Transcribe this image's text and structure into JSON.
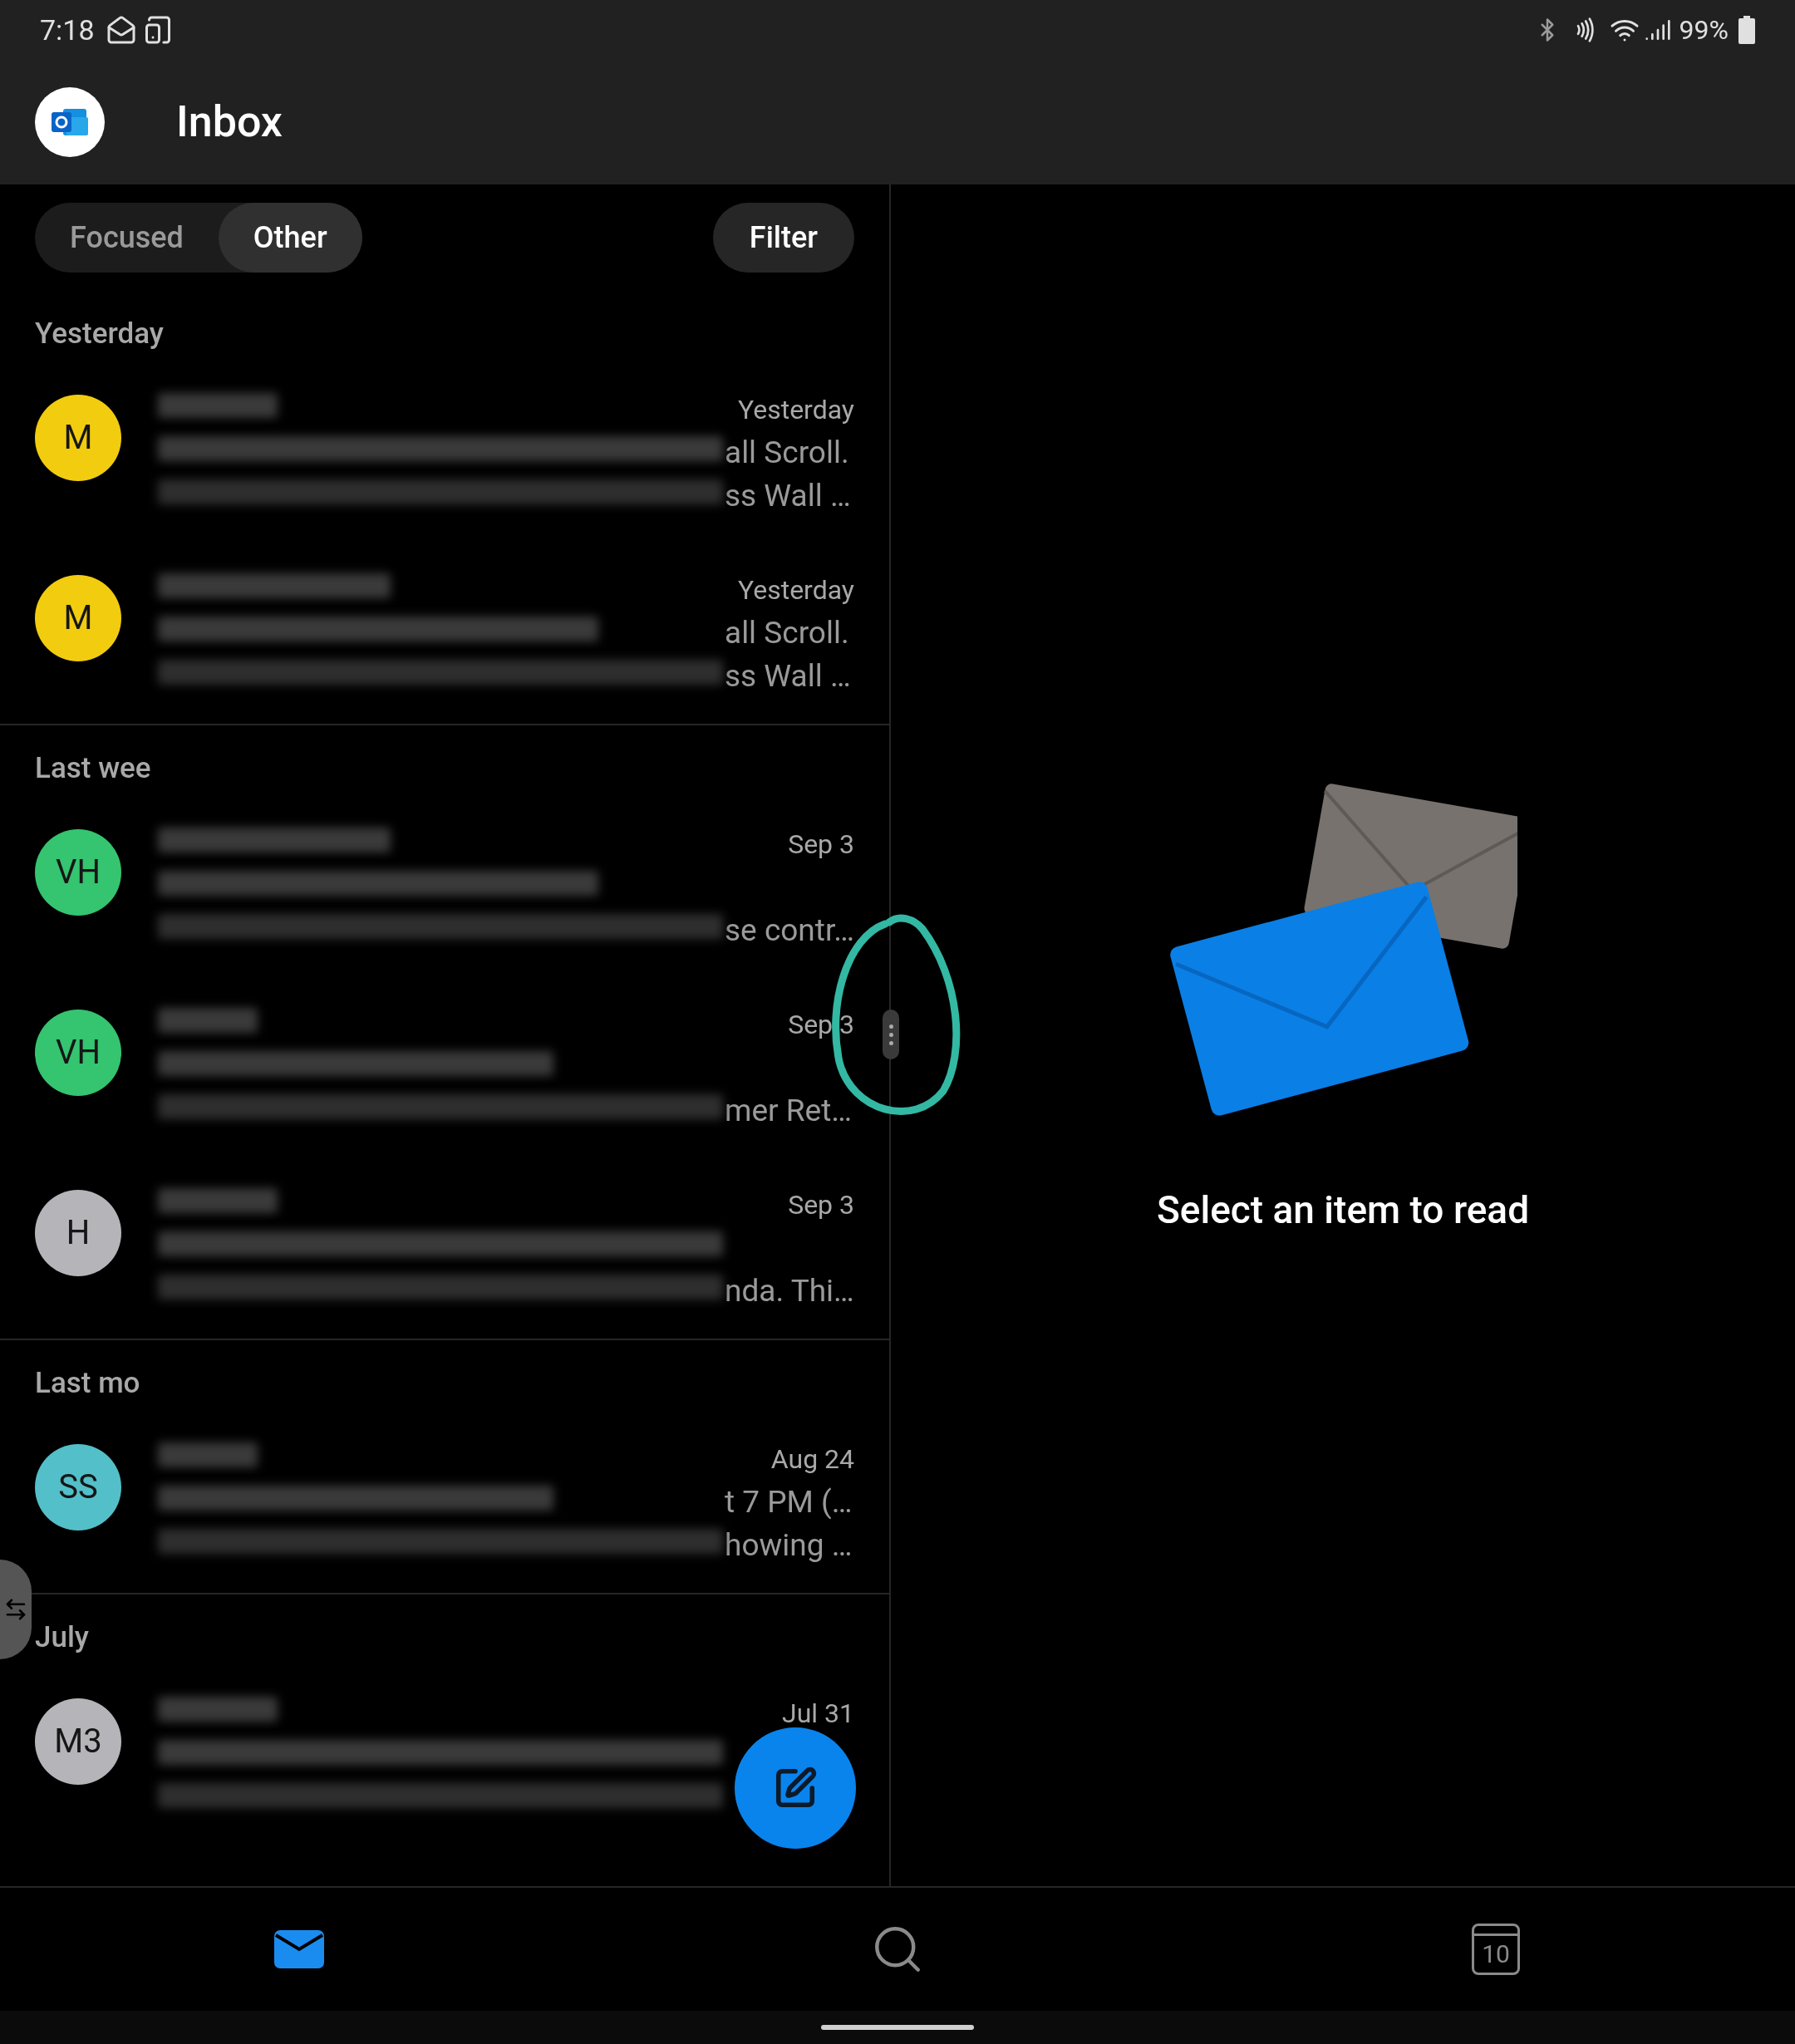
{
  "status_bar": {
    "time": "7:18",
    "battery": "99%"
  },
  "header": {
    "title": "Inbox"
  },
  "tabs": [
    {
      "label": "Focused",
      "selected": false
    },
    {
      "label": "Other",
      "selected": true
    }
  ],
  "filter_button": "Filter",
  "sections": [
    {
      "heading": "Yesterday",
      "messages": [
        {
          "initials": "M",
          "color": "#f2cc0f",
          "date": "Yesterday",
          "subject_tail": "all Scroll.",
          "preview_tail": "ss Wall …"
        },
        {
          "initials": "M",
          "color": "#f2cc0f",
          "date": "Yesterday",
          "subject_tail": "all Scroll.",
          "preview_tail": "ss Wall …"
        }
      ]
    },
    {
      "heading": "Last wee",
      "messages": [
        {
          "initials": "VH",
          "color": "#35c46f",
          "date": "Sep 3",
          "preview_tail": "se contr…"
        },
        {
          "initials": "VH",
          "color": "#35c46f",
          "date": "Sep 3",
          "preview_tail": "mer Ret…"
        },
        {
          "initials": "H",
          "color": "#b5b4b9",
          "date": "Sep 3",
          "preview_tail": "nda. Thi…"
        }
      ]
    },
    {
      "heading": "Last mo",
      "messages": [
        {
          "initials": "SS",
          "color": "#53bfc9",
          "date": "Aug 24",
          "subject_tail": "t 7 PM (…",
          "preview_tail": "howing …"
        }
      ]
    },
    {
      "heading": "July",
      "messages": [
        {
          "initials": "M3",
          "color": "#b5b4b9",
          "date": "Jul 31"
        }
      ]
    }
  ],
  "reading_pane": {
    "message": "Select an item to read"
  },
  "bottom_nav": [
    {
      "kind": "mail",
      "selected": true
    },
    {
      "kind": "search",
      "selected": false
    },
    {
      "kind": "calendar",
      "selected": false,
      "label": "10"
    }
  ]
}
